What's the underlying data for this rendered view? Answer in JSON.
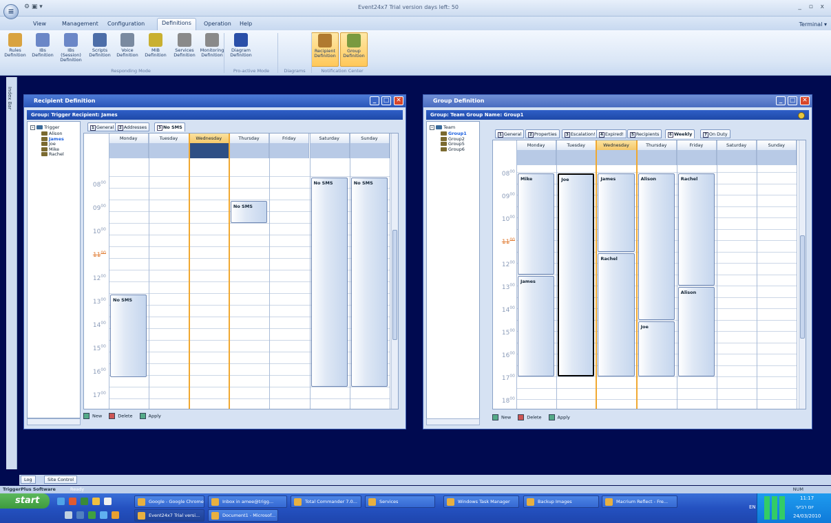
{
  "app": {
    "title": "Event24x7 Trial version days left: 50",
    "orb_label": "≡",
    "quick_access": "⚙ ▣ ▾",
    "window_controls": "_  ▫  x",
    "terminal": "Terminal ▾"
  },
  "menu": [
    "View",
    "Management",
    "Configuration",
    "Definitions",
    "Operation",
    "Help"
  ],
  "ribbon": {
    "buttons": [
      {
        "l1": "Rules",
        "l2": "Definition",
        "color": "#d9a340"
      },
      {
        "l1": "IBs",
        "l2": "Definition",
        "color": "#6b87c7"
      },
      {
        "l1": "IBs (Session)",
        "l2": "Definition",
        "color": "#6b87c7"
      },
      {
        "l1": "Scripts",
        "l2": "Definition",
        "color": "#4d6ea8"
      },
      {
        "l1": "Voice",
        "l2": "Definition",
        "color": "#7a8aa0"
      },
      {
        "l1": "MIB",
        "l2": "Definition",
        "color": "#c9b030"
      },
      {
        "l1": "Services",
        "l2": "Definition",
        "color": "#8a8a8a"
      },
      {
        "l1": "Monitoring",
        "l2": "Definition",
        "color": "#8a8a8a"
      },
      {
        "l1": "Diagram",
        "l2": "Definition",
        "color": "#2a4fa8"
      },
      {
        "l1": "Recipient",
        "l2": "Definition",
        "color": "#b07a30"
      },
      {
        "l1": "Group",
        "l2": "Definition",
        "color": "#7a9a40"
      }
    ],
    "groups": [
      "Responding Mode",
      "Pro-active Mode",
      "Diagrams",
      "Notification Center"
    ]
  },
  "left_strip": "Index Bar",
  "recipient_window": {
    "title": "Recipient Definition",
    "group_bar": "Group: Trigger Recipient: James",
    "tree_root": "Trigger",
    "tree_items": [
      "Alison",
      "James",
      "Joe",
      "Mike",
      "Rachel"
    ],
    "tabs": [
      {
        "n": "1",
        "label": "General"
      },
      {
        "n": "2",
        "label": "Addresses"
      },
      {
        "n": "3",
        "label": "No SMS"
      }
    ],
    "days": [
      "Monday",
      "Tuesday",
      "Wednesday",
      "Thursday",
      "Friday",
      "Saturday",
      "Sunday"
    ],
    "hours": [
      "08",
      "09",
      "10",
      "11",
      "12",
      "13",
      "14",
      "15",
      "16",
      "17"
    ],
    "appointments": [
      {
        "day": 0,
        "start": 13,
        "end": 16.6,
        "text": "No SMS"
      },
      {
        "day": 3,
        "start": 9,
        "end": 10,
        "text": "No SMS"
      },
      {
        "day": 5,
        "start": 8,
        "end": 17,
        "text": "No SMS"
      },
      {
        "day": 6,
        "start": 8,
        "end": 17,
        "text": "No SMS"
      }
    ],
    "toolbar": [
      "New",
      "Delete",
      "Apply"
    ]
  },
  "group_window": {
    "title": "Group Definition",
    "group_bar": "Group: Team Group Name: Group1",
    "tree_root": "Team",
    "tree_items": [
      "Group1",
      "Group2",
      "Group5",
      "Group6"
    ],
    "tabs": [
      {
        "n": "1",
        "label": "General"
      },
      {
        "n": "2",
        "label": "Properties"
      },
      {
        "n": "3",
        "label": "Escalation!"
      },
      {
        "n": "4",
        "label": "Expired!"
      },
      {
        "n": "5",
        "label": "Recipients"
      },
      {
        "n": "6",
        "label": "Weekly"
      },
      {
        "n": "7",
        "label": "On Duty"
      }
    ],
    "days": [
      "Monday",
      "Tuesday",
      "Wednesday",
      "Thursday",
      "Friday",
      "Saturday",
      "Sunday"
    ],
    "hours": [
      "08",
      "09",
      "10",
      "11",
      "12",
      "13",
      "14",
      "15",
      "16",
      "17",
      "18"
    ],
    "appointments": [
      {
        "day": 0,
        "start": 8,
        "end": 12.5,
        "text": "Mike"
      },
      {
        "day": 0,
        "start": 12.5,
        "end": 17,
        "text": "James"
      },
      {
        "day": 1,
        "start": 8,
        "end": 17,
        "text": "Joe",
        "sel": true
      },
      {
        "day": 2,
        "start": 8,
        "end": 11.5,
        "text": "James"
      },
      {
        "day": 2,
        "start": 11.5,
        "end": 17,
        "text": "Rachel"
      },
      {
        "day": 3,
        "start": 8,
        "end": 14.5,
        "text": "Alison"
      },
      {
        "day": 3,
        "start": 14.5,
        "end": 17,
        "text": "Joe"
      },
      {
        "day": 4,
        "start": 8,
        "end": 13,
        "text": "Rachel"
      },
      {
        "day": 4,
        "start": 13,
        "end": 17,
        "text": "Alison"
      }
    ],
    "toolbar": [
      "New",
      "Delete",
      "Apply"
    ]
  },
  "bottom_tabs": [
    "Log",
    "Site Control"
  ],
  "status": {
    "left": "TriggerPlus Software",
    "state": "Ready",
    "right": "NUM"
  },
  "taskbar": {
    "start": "start",
    "row1": [
      "Google - Google Chrome",
      "Inbox in amee@trigg...",
      "Total Commander 7.0...",
      "Services",
      "Windows Task Manager",
      "Backup Images",
      "Macrium Reflect - Fre..."
    ],
    "row2": [
      "Event24x7 Trial versi...",
      "Document1 - Microsof..."
    ],
    "lang": "EN",
    "time": "11:17",
    "day": "יום רביעי",
    "date": "24/03/2010"
  }
}
